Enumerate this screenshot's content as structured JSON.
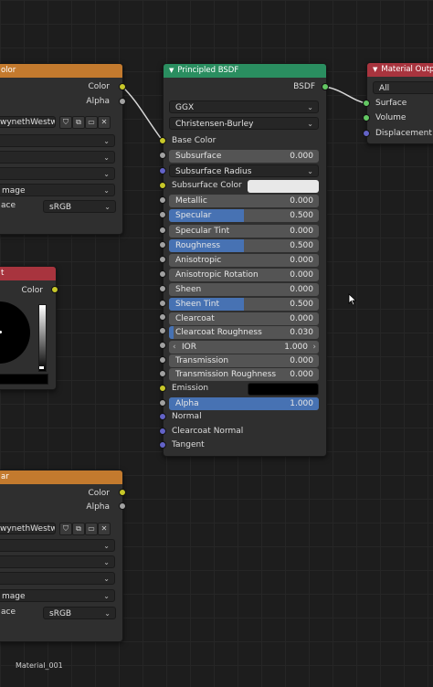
{
  "image_node_top": {
    "title": "olor",
    "outputs": [
      "Color",
      "Alpha"
    ],
    "image_name": "wynethWestwo...",
    "dropdowns": [
      "",
      "",
      ""
    ],
    "source_label": "mage",
    "colorspace_label": "ace",
    "colorspace_value": "sRGB"
  },
  "image_node_bottom": {
    "title": "ar",
    "outputs": [
      "Color",
      "Alpha"
    ],
    "image_name": "wynethWestwo...",
    "dropdowns": [
      "",
      "",
      ""
    ],
    "source_label": "mage",
    "colorspace_label": "ace",
    "colorspace_value": "sRGB"
  },
  "rgb_node": {
    "title": "t",
    "output": "Color"
  },
  "bsdf": {
    "title": "Principled BSDF",
    "output": "BSDF",
    "distribution": "GGX",
    "subsurface_method": "Christensen-Burley",
    "base_color_label": "Base Color",
    "subsurface_radius_label": "Subsurface Radius",
    "subsurface_color_label": "Subsurface Color",
    "subsurface_color_hex": "#e8e8e8",
    "emission_label": "Emission",
    "emission_color_hex": "#000000",
    "fields": [
      {
        "label": "Subsurface",
        "value": "0.000",
        "fraction": 0,
        "centered": false
      },
      {
        "label": "Metallic",
        "value": "0.000",
        "fraction": 0,
        "centered": false
      },
      {
        "label": "Specular",
        "value": "0.500",
        "fraction": 0.5,
        "centered": false
      },
      {
        "label": "Specular Tint",
        "value": "0.000",
        "fraction": 0,
        "centered": false
      },
      {
        "label": "Roughness",
        "value": "0.500",
        "fraction": 0.5,
        "centered": false
      },
      {
        "label": "Anisotropic",
        "value": "0.000",
        "fraction": 0,
        "centered": false
      },
      {
        "label": "Anisotropic Rotation",
        "value": "0.000",
        "fraction": 0,
        "centered": false
      },
      {
        "label": "Sheen",
        "value": "0.000",
        "fraction": 0,
        "centered": false
      },
      {
        "label": "Sheen Tint",
        "value": "0.500",
        "fraction": 0.5,
        "centered": false
      },
      {
        "label": "Clearcoat",
        "value": "0.000",
        "fraction": 0,
        "centered": false
      },
      {
        "label": "Clearcoat Roughness",
        "value": "0.030",
        "fraction": 0.03,
        "centered": false
      },
      {
        "label": "IOR",
        "value": "1.000",
        "fraction": 0,
        "centered": true
      },
      {
        "label": "Transmission",
        "value": "0.000",
        "fraction": 0,
        "centered": false
      },
      {
        "label": "Transmission Roughness",
        "value": "0.000",
        "fraction": 0,
        "centered": false
      }
    ],
    "alpha": {
      "label": "Alpha",
      "value": "1.000",
      "fraction": 1
    },
    "vector_inputs": [
      "Normal",
      "Clearcoat Normal",
      "Tangent"
    ]
  },
  "material_output": {
    "title": "Material Output",
    "target": "All",
    "inputs": [
      "Surface",
      "Volume",
      "Displacement"
    ]
  },
  "footer_label": "Material_001",
  "colors": {
    "image_header": "#c37a2e",
    "bsdf_header": "#2a8e60",
    "output_header": "#a8343e",
    "slider_fill": "#4772b3",
    "link": "#d8d8d8"
  }
}
